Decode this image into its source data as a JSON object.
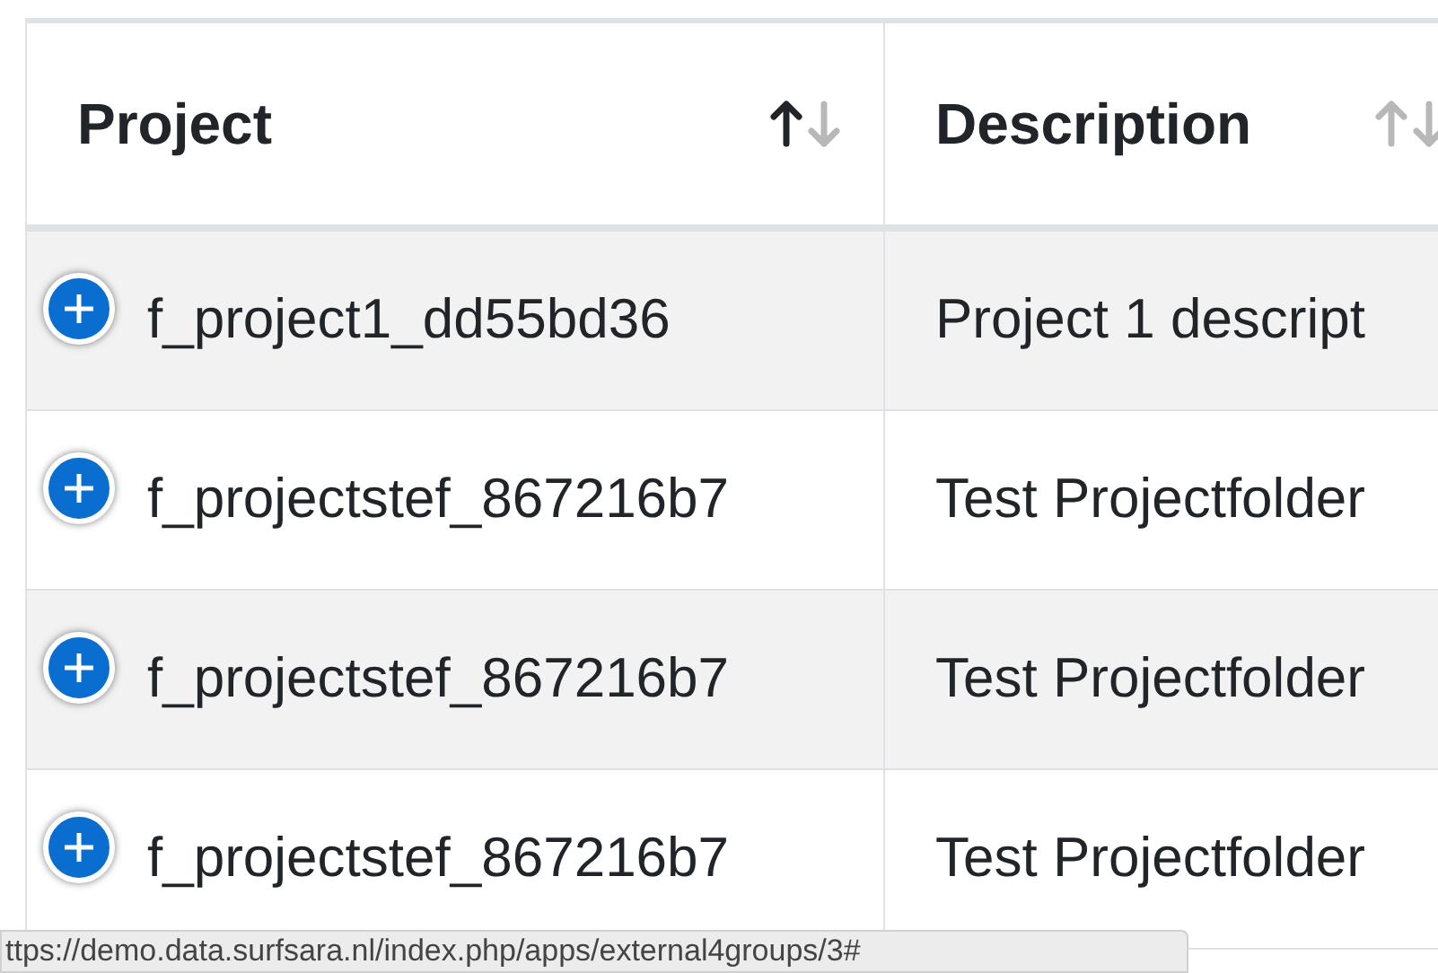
{
  "table": {
    "columns": [
      {
        "label": "Project",
        "sorted": true
      },
      {
        "label": "Description",
        "sorted": false
      }
    ],
    "rows": [
      {
        "project": "f_project1_dd55bd36",
        "description": "Project 1 descript"
      },
      {
        "project": "f_projectstef_867216b7",
        "description": "Test Projectfolder"
      },
      {
        "project": "f_projectstef_867216b7",
        "description": "Test Projectfolder"
      },
      {
        "project": "f_projectstef_867216b7",
        "description": "Test Projectfolder"
      }
    ]
  },
  "status_bar": {
    "url": "ttps://demo.data.surfsara.nl/index.php/apps/external4groups/3#"
  }
}
